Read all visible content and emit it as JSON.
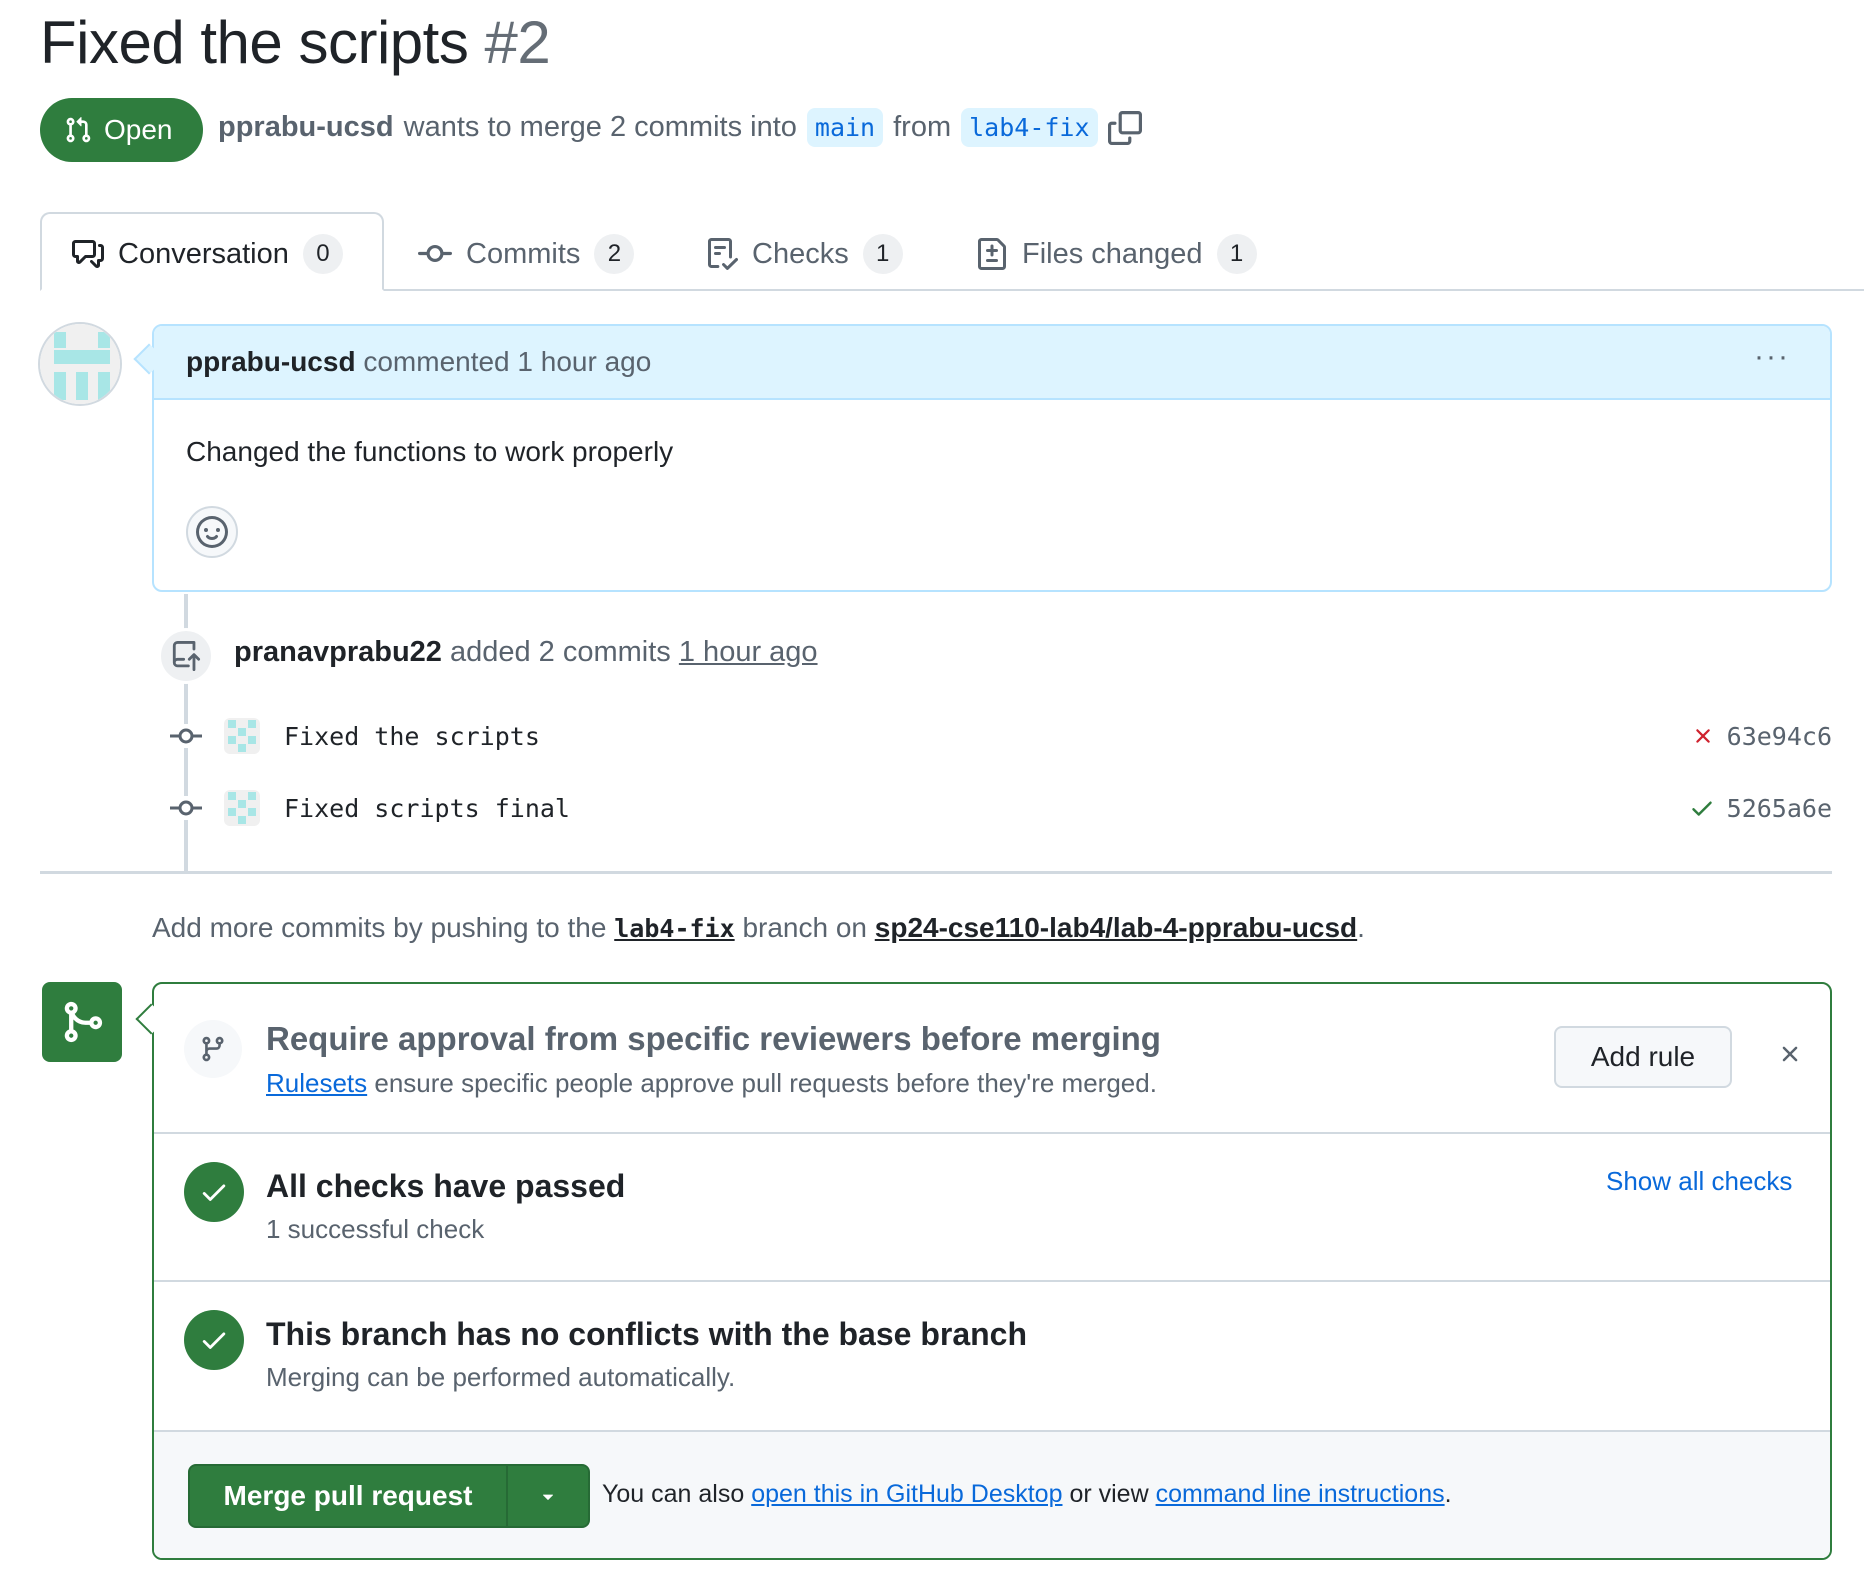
{
  "pr": {
    "title": "Fixed the scripts",
    "number": "#2",
    "state": "Open",
    "author": "pprabu-ucsd",
    "merge_text": "wants to merge 2 commits into",
    "base_branch": "main",
    "from_text": "from",
    "head_branch": "lab4-fix"
  },
  "tabs": [
    {
      "label": "Conversation",
      "count": "0",
      "icon": "comment-discussion-icon"
    },
    {
      "label": "Commits",
      "count": "2",
      "icon": "git-commit-icon"
    },
    {
      "label": "Checks",
      "count": "1",
      "icon": "checklist-icon"
    },
    {
      "label": "Files changed",
      "count": "1",
      "icon": "file-diff-icon"
    }
  ],
  "comment": {
    "author": "pprabu-ucsd",
    "meta": "commented 1 hour ago",
    "body": "Changed the functions to work properly",
    "menu": "···"
  },
  "timeline": {
    "actor": "pranavprabu22",
    "action": "added 2 commits",
    "time": "1 hour ago",
    "commits": [
      {
        "message": "Fixed the scripts",
        "sha": "63e94c6",
        "status": "failure"
      },
      {
        "message": "Fixed scripts final",
        "sha": "5265a6e",
        "status": "success"
      }
    ]
  },
  "push_note": {
    "prefix": "Add more commits by pushing to the",
    "branch": "lab4-fix",
    "middle": "branch on",
    "repo": "sp24-cse110-lab4/lab-4-pprabu-ucsd",
    "suffix": "."
  },
  "merge_box": {
    "rule_title": "Require approval from specific reviewers before merging",
    "rule_link": "Rulesets",
    "rule_sub": "ensure specific people approve pull requests before they're merged.",
    "add_rule": "Add rule",
    "checks_title": "All checks have passed",
    "checks_sub": "1 successful check",
    "show_checks": "Show all checks",
    "conflicts_title": "This branch has no conflicts with the base branch",
    "conflicts_sub": "Merging can be performed automatically.",
    "merge_button": "Merge pull request",
    "note_prefix": "You can also",
    "note_link1": "open this in GitHub Desktop",
    "note_middle": "or view",
    "note_link2": "command line instructions",
    "note_suffix": "."
  },
  "colors": {
    "success": "#2f7d3e",
    "link": "#0969da",
    "danger": "#cf222e",
    "muted": "#59636e",
    "branch_bg": "#ddf4ff"
  }
}
